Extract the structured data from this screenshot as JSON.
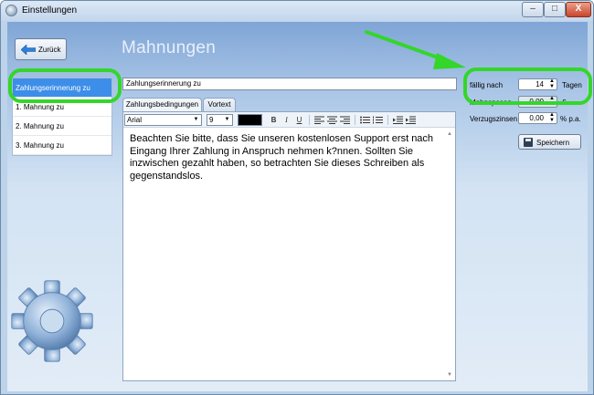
{
  "window": {
    "title": "Einstellungen"
  },
  "title_controls": {
    "minimize": "–",
    "maximize": "□",
    "close": "X"
  },
  "back_button": {
    "label": "Zurück"
  },
  "page": {
    "title": "Mahnungen"
  },
  "sidebar": {
    "items": [
      {
        "label": "Zahlungserinnerung zu"
      },
      {
        "label": "1. Mahnung zu"
      },
      {
        "label": "2. Mahnung zu"
      },
      {
        "label": "3. Mahnung zu"
      }
    ],
    "selected_index": 0
  },
  "name_field": {
    "value": "Zahlungserinnerung zu"
  },
  "tabs": [
    {
      "label": "Zahlungsbedingungen"
    },
    {
      "label": "Vortext"
    }
  ],
  "toolbar": {
    "font": "Arial",
    "size": "9",
    "color": "#000000",
    "bold": "B",
    "italic": "I",
    "underline": "U",
    "icons": [
      "bold-icon",
      "italic-icon",
      "underline-icon",
      "align-left-icon",
      "align-center-icon",
      "align-right-icon",
      "bullet-list-icon",
      "numbered-list-icon",
      "indent-decrease-icon",
      "indent-increase-icon"
    ]
  },
  "editor": {
    "text": "Beachten Sie bitte, dass Sie unseren kostenlosen Support erst nach Eingang Ihrer Zahlung in Anspruch nehmen k?nnen. Sollten Sie inzwischen gezahlt haben, so betrachten Sie dieses Schreiben als gegenstandslos."
  },
  "settings": {
    "due": {
      "label": "fällig nach",
      "value": "14",
      "unit": "Tagen"
    },
    "fees": {
      "label": "Mahnspesen",
      "value": "0,00",
      "unit": "€"
    },
    "interest": {
      "label": "Verzugszinsen",
      "value": "0,00",
      "unit": "% p.a."
    }
  },
  "save_button": {
    "label": "Speichern"
  },
  "accent_colors": {
    "highlight": "#34d62a",
    "selected": "#3d8ee8"
  }
}
